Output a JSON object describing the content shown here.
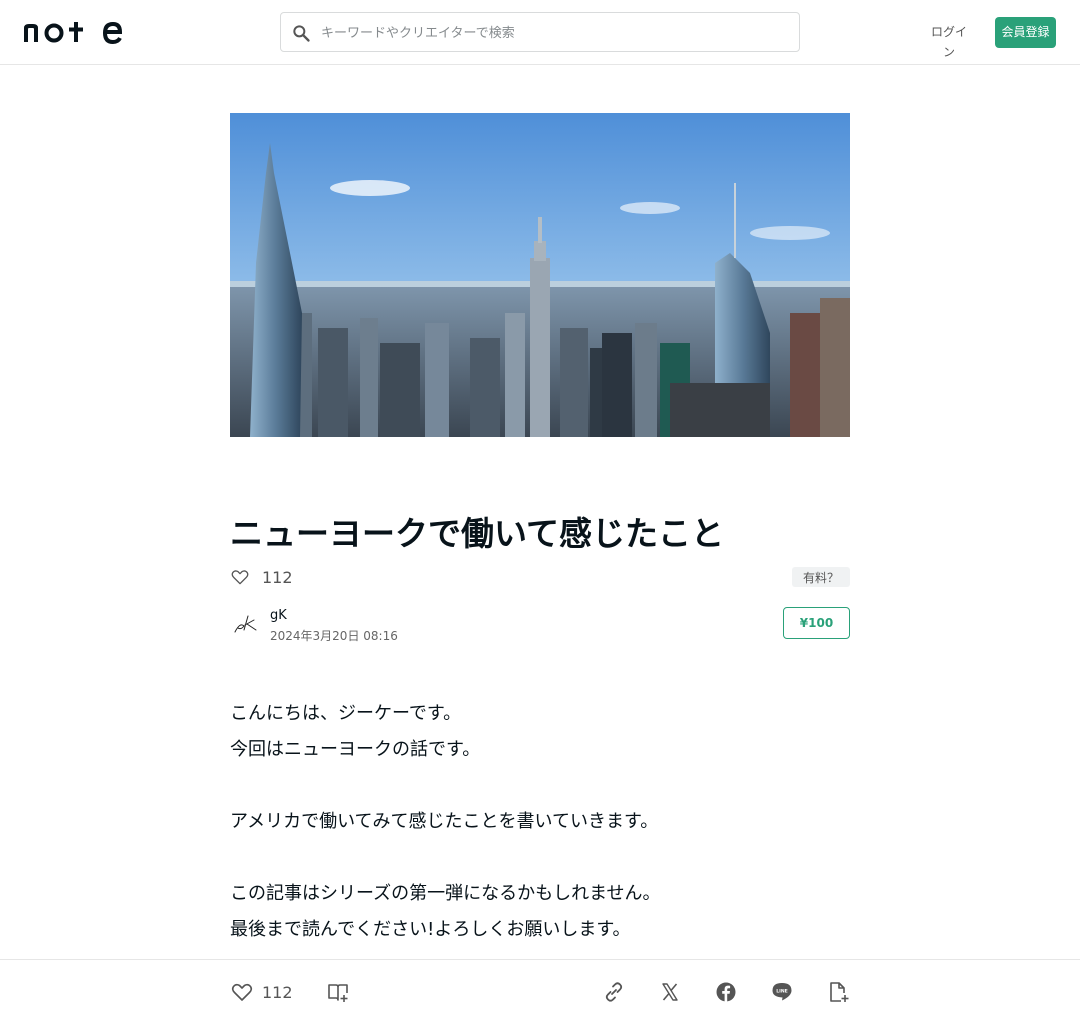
{
  "header": {
    "logo_text": "note",
    "search_placeholder": "キーワードやクリエイターで検索",
    "login_label": "ログイン",
    "signup_label": "会員登録"
  },
  "article": {
    "hero_alt": "ニューヨークの高層ビル群",
    "title": "ニューヨークで働いて感じたこと",
    "like_count": "112",
    "paid_badge": "有料？",
    "author_name": "gK",
    "published": "2024年3月20日 08:16",
    "price": "¥100",
    "body": [
      "こんにちは、ジーケーです。",
      "今回はニューヨークの話です。",
      "",
      "アメリカで働いてみて感じたことを書いていきます。",
      "",
      "この記事はシリーズの第一弾になるかもしれません。",
      "最後まで読んでください!よろしくお願いします。"
    ]
  },
  "footer": {
    "like_count": "112"
  },
  "colors": {
    "accent": "#2aa179",
    "text": "#08131a",
    "border": "#e6e6e6"
  },
  "icons": [
    "search-icon",
    "heart-icon",
    "question-icon",
    "magazine-add-icon",
    "link-icon",
    "x-icon",
    "facebook-icon",
    "line-icon",
    "document-add-icon"
  ]
}
